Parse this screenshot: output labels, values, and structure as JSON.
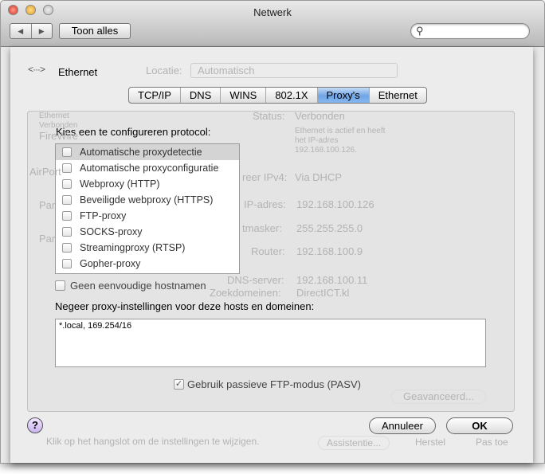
{
  "window": {
    "title": "Netwerk",
    "show_all": "Toon alles",
    "back_icon": "◀",
    "forward_icon": "▶",
    "search_icon": "magnifier"
  },
  "background": {
    "location_label": "Locatie:",
    "location_value": "Automatisch",
    "sidebar": [
      "Ethernet",
      "Verbonden",
      "FireWire",
      "AirPort",
      "Par",
      "Par"
    ],
    "status_label": "Status:",
    "status_value": "Verbonden",
    "status_desc": "Ethernet is actief en heeft het IP-adres 192.168.100.126.",
    "configure_label": "reer IPv4:",
    "configure_value": "Via DHCP",
    "ip_label": "IP-adres:",
    "ip_value": "192.168.100.126",
    "mask_label": "tmasker:",
    "mask_value": "255.255.255.0",
    "router_label": "Router:",
    "router_value": "192.168.100.9",
    "dns_label": "DNS-server:",
    "dns_value": "192.168.100.11",
    "search_label": "Zoekdomeinen:",
    "search_value": "DirectICT.kl",
    "advanced": "Geavanceerd...",
    "lock_text": "Klik op het hangslot om de instellingen te wijzigen.",
    "assist": "Assistentie...",
    "revert": "Herstel",
    "apply": "Pas toe"
  },
  "sheet": {
    "interface": "Ethernet",
    "tabs": [
      {
        "label": "TCP/IP"
      },
      {
        "label": "DNS"
      },
      {
        "label": "WINS"
      },
      {
        "label": "802.1X"
      },
      {
        "label": "Proxy's",
        "active": true
      },
      {
        "label": "Ethernet"
      }
    ],
    "protocol_heading": "Kies een te configureren protocol:",
    "protocols": [
      {
        "label": "Automatische proxydetectie",
        "checked": false,
        "selected": true
      },
      {
        "label": "Automatische proxyconfiguratie",
        "checked": false
      },
      {
        "label": "Webproxy (HTTP)",
        "checked": false
      },
      {
        "label": "Beveiligde webproxy (HTTPS)",
        "checked": false
      },
      {
        "label": "FTP-proxy",
        "checked": false
      },
      {
        "label": "SOCKS-proxy",
        "checked": false
      },
      {
        "label": "Streamingproxy (RTSP)",
        "checked": false
      },
      {
        "label": "Gopher-proxy",
        "checked": false
      }
    ],
    "no_simple_hostnames": {
      "label": "Geen eenvoudige hostnamen",
      "checked": false
    },
    "bypass_heading": "Negeer proxy-instellingen voor deze hosts en domeinen:",
    "bypass_value": "*.local, 169.254/16",
    "pasv": {
      "label": "Gebruik passieve FTP-modus (PASV)",
      "checked": true
    },
    "help": "?",
    "cancel": "Annuleer",
    "ok": "OK"
  }
}
